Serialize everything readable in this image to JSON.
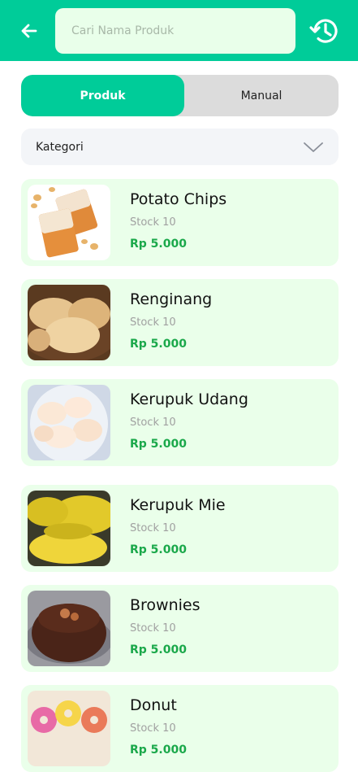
{
  "header": {
    "search_placeholder": "Cari Nama Produk",
    "colors": {
      "header_bg": "#00cc99",
      "search_bg": "#e9ffea"
    },
    "icons": {
      "back": "arrow-left-icon",
      "history": "history-clock-icon"
    }
  },
  "tabs": [
    {
      "label": "Produk",
      "active": true
    },
    {
      "label": "Manual",
      "active": false
    }
  ],
  "category": {
    "label": "Kategori",
    "icon": "chevron-down-icon"
  },
  "products": [
    {
      "name": "Potato Chips",
      "stock": "Stock 10",
      "price": "Rp 5.000",
      "image": "potato-chips-photo"
    },
    {
      "name": "Renginang",
      "stock": "Stock 10",
      "price": "Rp 5.000",
      "image": "renginang-photo"
    },
    {
      "name": "Kerupuk Udang",
      "stock": "Stock 10",
      "price": "Rp 5.000",
      "image": "kerupuk-udang-photo"
    },
    {
      "name": "Kerupuk Mie",
      "stock": "Stock 10",
      "price": "Rp 5.000",
      "image": "kerupuk-mie-photo"
    },
    {
      "name": "Brownies",
      "stock": "Stock 10",
      "price": "Rp 5.000",
      "image": "brownies-photo"
    },
    {
      "name": "Donut",
      "stock": "Stock 10",
      "price": "Rp 5.000",
      "image": "donut-photo"
    }
  ],
  "colors": {
    "accent": "#00cc99",
    "card_bg": "#eaffea",
    "price": "#1aa84a",
    "tab_inactive": "#dcdcdc"
  }
}
